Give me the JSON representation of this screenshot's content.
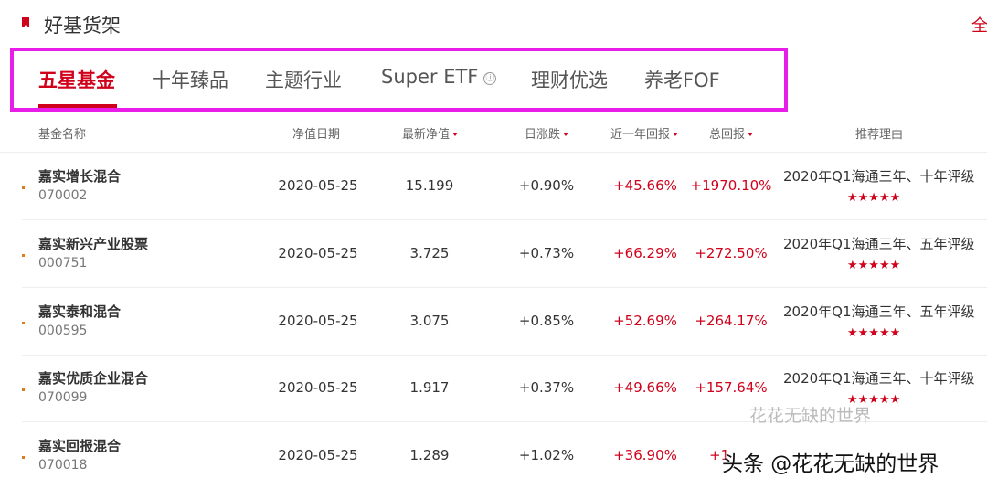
{
  "header": {
    "title": "好基货架",
    "more_label": "全"
  },
  "tabs": [
    {
      "label": "五星基金",
      "active": true
    },
    {
      "label": "十年臻品"
    },
    {
      "label": "主题行业"
    },
    {
      "label": "Super ETF",
      "info_glyph": "ⓘ"
    },
    {
      "label": "理财优选"
    },
    {
      "label": "养老FOF"
    }
  ],
  "columns": {
    "name": "基金名称",
    "date": "净值日期",
    "nav": "最新净值",
    "daily": "日涨跌",
    "year": "近一年回报",
    "total": "总回报",
    "reason": "推荐理由"
  },
  "rows": [
    {
      "name": "嘉实增长混合",
      "code": "070002",
      "date": "2020-05-25",
      "nav": "15.199",
      "daily": "+0.90%",
      "year": "+45.66%",
      "total": "+1970.10%",
      "reason": "2020年Q1海通三年、十年评级",
      "stars": "★★★★★"
    },
    {
      "name": "嘉实新兴产业股票",
      "code": "000751",
      "date": "2020-05-25",
      "nav": "3.725",
      "daily": "+0.73%",
      "year": "+66.29%",
      "total": "+272.50%",
      "reason": "2020年Q1海通三年、五年评级",
      "stars": "★★★★★"
    },
    {
      "name": "嘉实泰和混合",
      "code": "000595",
      "date": "2020-05-25",
      "nav": "3.075",
      "daily": "+0.85%",
      "year": "+52.69%",
      "total": "+264.17%",
      "reason": "2020年Q1海通三年、五年评级",
      "stars": "★★★★★"
    },
    {
      "name": "嘉实优质企业混合",
      "code": "070099",
      "date": "2020-05-25",
      "nav": "1.917",
      "daily": "+0.37%",
      "year": "+49.66%",
      "total": "+157.64%",
      "reason": "2020年Q1海通三年、十年评级",
      "stars": "★★★★★"
    },
    {
      "name": "嘉实回报混合",
      "code": "070018",
      "date": "2020-05-25",
      "nav": "1.289",
      "daily": "+1.02%",
      "year": "+36.90%",
      "total": "+1",
      "reason": "",
      "stars": ""
    }
  ],
  "watermark": {
    "text": "头条 @花花无缺的世界",
    "ghost": "花花无缺的世界"
  },
  "colors": {
    "accent": "#d0021b",
    "highlight_border": "#e81ee8"
  }
}
